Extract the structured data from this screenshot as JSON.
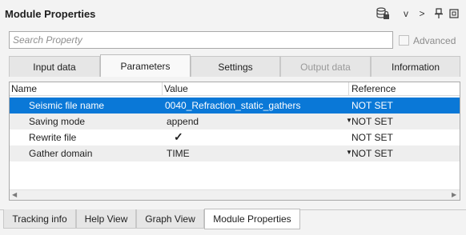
{
  "window": {
    "title": "Module Properties",
    "toolbar": {
      "dropdown_glyph": "v",
      "next_glyph": ">",
      "pin_glyph": "⊥",
      "restore_glyph": "▣"
    }
  },
  "search": {
    "placeholder": "Search Property",
    "value": "",
    "advanced_label": "Advanced",
    "advanced_checked": false
  },
  "tabs": [
    {
      "label": "Input data",
      "state": "normal"
    },
    {
      "label": "Parameters",
      "state": "active"
    },
    {
      "label": "Settings",
      "state": "normal"
    },
    {
      "label": "Output data",
      "state": "disabled"
    },
    {
      "label": "Information",
      "state": "normal"
    }
  ],
  "grid": {
    "columns": {
      "name": "Name",
      "value": "Value",
      "reference": "Reference"
    },
    "rows": [
      {
        "name": "Seismic file name",
        "value": "0040_Refraction_static_gathers",
        "reference": "NOT SET",
        "selected": true
      },
      {
        "name": "Saving mode",
        "value": "append",
        "reference": "NOT SET",
        "dropdown": true
      },
      {
        "name": "Rewrite file",
        "value": "✓",
        "reference": "NOT SET",
        "checkbox": true
      },
      {
        "name": "Gather domain",
        "value": "TIME",
        "reference": "NOT SET",
        "dropdown": true
      }
    ]
  },
  "bottom_tabs": [
    {
      "label": "Tracking info",
      "state": "normal"
    },
    {
      "label": "Help View",
      "state": "normal"
    },
    {
      "label": "Graph View",
      "state": "normal"
    },
    {
      "label": "Module Properties",
      "state": "active"
    }
  ],
  "colors": {
    "selection": "#0a78d7",
    "alt_row": "#eeeeee",
    "background": "#f3f3f3"
  }
}
